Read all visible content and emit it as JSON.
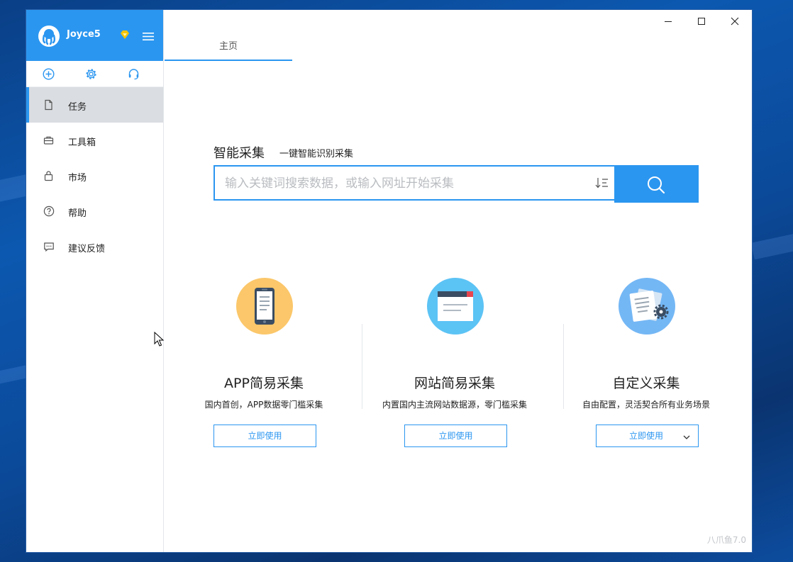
{
  "sidebar": {
    "username": "Joyce5",
    "nav": [
      {
        "label": "任务"
      },
      {
        "label": "工具箱"
      },
      {
        "label": "市场"
      },
      {
        "label": "帮助"
      },
      {
        "label": "建议反馈"
      }
    ]
  },
  "tabs": {
    "home": "主页"
  },
  "smart": {
    "title": "智能采集",
    "subtitle": "一键智能识别采集",
    "placeholder": "输入关键词搜索数据，或输入网址开始采集"
  },
  "cards": [
    {
      "title": "APP简易采集",
      "desc": "国内首创，APP数据零门槛采集",
      "button": "立即使用"
    },
    {
      "title": "网站简易采集",
      "desc": "内置国内主流网站数据源，零门槛采集",
      "button": "立即使用"
    },
    {
      "title": "自定义采集",
      "desc": "自由配置，灵活契合所有业务场景",
      "button": "立即使用"
    }
  ],
  "version": "八爪鱼7.0",
  "colors": {
    "accent": "#2b96f0",
    "active_nav": "#dadde1"
  }
}
